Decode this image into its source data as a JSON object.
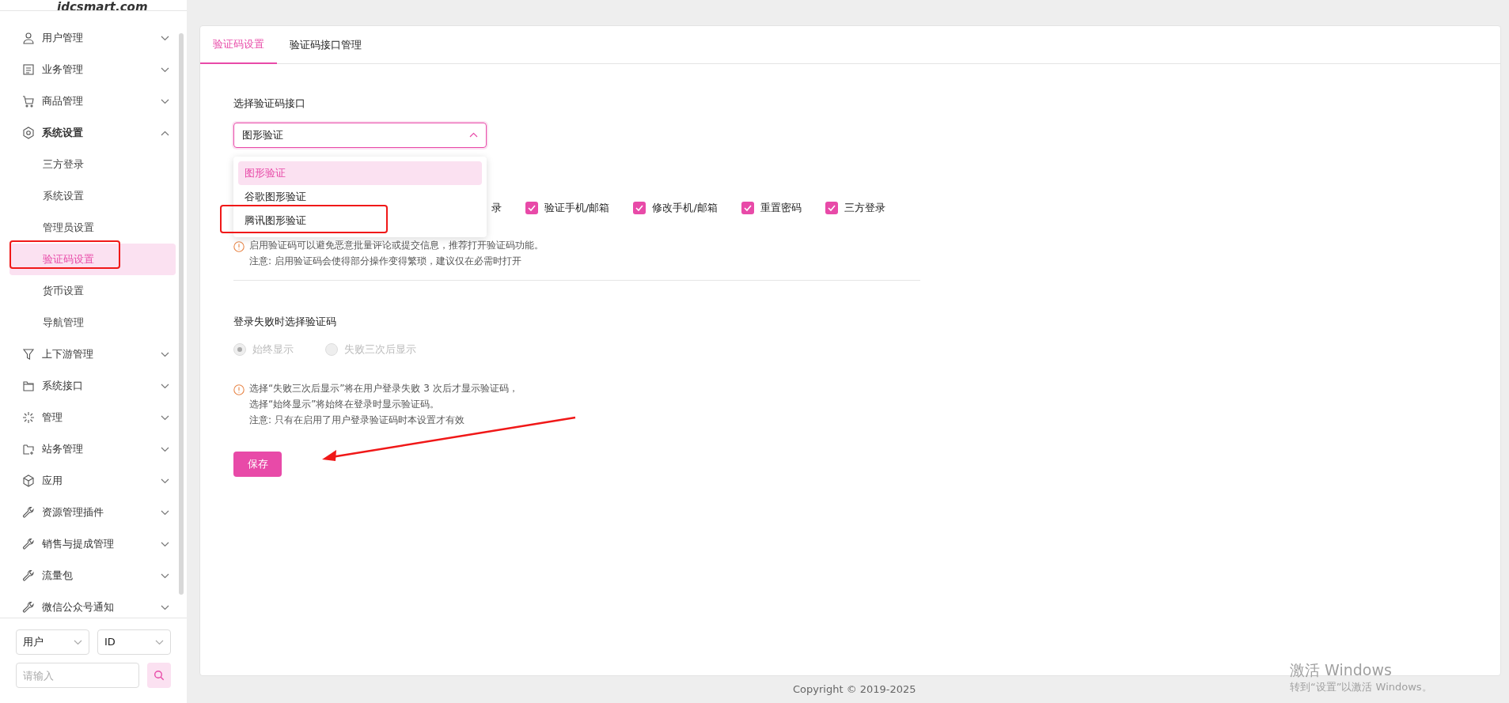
{
  "logo": {
    "text": "idcsmart.com"
  },
  "sidebar": {
    "items": [
      {
        "label": "用户管理",
        "expanded": false
      },
      {
        "label": "业务管理",
        "expanded": false
      },
      {
        "label": "商品管理",
        "expanded": false
      },
      {
        "label": "系统设置",
        "expanded": true,
        "children": [
          {
            "label": "三方登录",
            "selected": false
          },
          {
            "label": "系统设置",
            "selected": false
          },
          {
            "label": "管理员设置",
            "selected": false
          },
          {
            "label": "验证码设置",
            "selected": true
          },
          {
            "label": "货币设置",
            "selected": false
          },
          {
            "label": "导航管理",
            "selected": false
          }
        ]
      },
      {
        "label": "上下游管理",
        "expanded": false
      },
      {
        "label": "系统接口",
        "expanded": false
      },
      {
        "label": "管理",
        "expanded": false
      },
      {
        "label": "站务管理",
        "expanded": false
      },
      {
        "label": "应用",
        "expanded": false
      },
      {
        "label": "资源管理插件",
        "expanded": false
      },
      {
        "label": "销售与提成管理",
        "expanded": false
      },
      {
        "label": "流量包",
        "expanded": false
      },
      {
        "label": "微信公众号通知",
        "expanded": false
      }
    ],
    "search": {
      "type_select": "用户",
      "field_select": "ID",
      "placeholder": "请输入"
    }
  },
  "tabs": [
    {
      "label": "验证码设置",
      "selected": true
    },
    {
      "label": "验证码接口管理",
      "selected": false
    }
  ],
  "captcha_interface": {
    "label": "选择验证码接口",
    "value": "图形验证",
    "expanded": true,
    "options": [
      {
        "label": "图形验证",
        "selected": true
      },
      {
        "label": "谷歌图形验证",
        "selected": false
      },
      {
        "label": "腾讯图形验证",
        "selected": false
      }
    ]
  },
  "captcha_scenes": [
    {
      "label": "录"
    },
    {
      "label": "验证手机/邮箱",
      "checked": true
    },
    {
      "label": "修改手机/邮箱",
      "checked": true
    },
    {
      "label": "重置密码",
      "checked": true
    },
    {
      "label": "三方登录",
      "checked": true
    }
  ],
  "captcha_notes": [
    "启用验证码可以避免恶意批量评论或提交信息，推荐打开验证码功能。",
    "注意: 启用验证码会使得部分操作变得繁琐，建议仅在必需时打开"
  ],
  "login_fail": {
    "label": "登录失败时选择验证码",
    "disabled": true,
    "options": [
      {
        "label": "始终显示",
        "selected": true
      },
      {
        "label": "失败三次后显示",
        "selected": false
      }
    ],
    "notes": [
      "选择“失败三次后显示”将在用户登录失败 3 次后才显示验证码，",
      "选择“始终显示”将始终在登录时显示验证码。",
      "注意: 只有在启用了用户登录验证码时本设置才有效"
    ]
  },
  "save_button": "保存",
  "footer": "Copyright © 2019-2025",
  "os_notice": {
    "title": "激活 Windows",
    "subtitle": "转到“设置”以激活 Windows。"
  }
}
